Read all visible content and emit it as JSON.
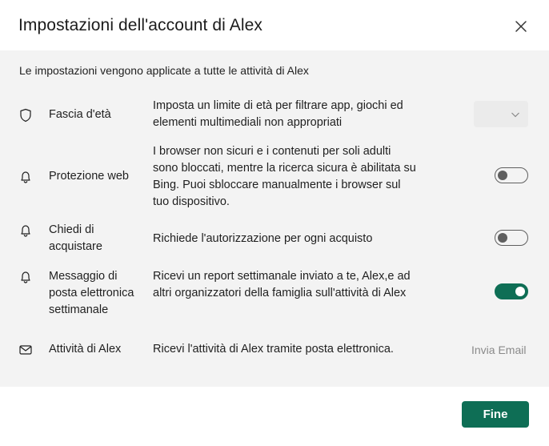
{
  "dialog": {
    "title": "Impostazioni dell'account di Alex",
    "intro": "Le impostazioni vengono applicate a tutte le attività di Alex"
  },
  "settings": [
    {
      "icon": "shield-icon",
      "name": "Fascia d'età",
      "description": "Imposta un limite di età per filtrare app, giochi ed elementi multimediali non appropriati",
      "control": "dropdown",
      "value": ""
    },
    {
      "icon": "bell-icon",
      "name": "Protezione web",
      "description": "I browser non sicuri e i contenuti per soli adulti sono bloccati, mentre la ricerca sicura è abilitata su Bing. Puoi sbloccare manualmente i browser sul tuo dispositivo.",
      "control": "toggle",
      "enabled": false
    },
    {
      "icon": "bell-icon",
      "name": "Chiedi di acquistare",
      "description": "Richiede l'autorizzazione per ogni acquisto",
      "control": "toggle",
      "enabled": false
    },
    {
      "icon": "bell-icon",
      "name": "Messaggio di posta elettronica settimanale",
      "description": "Ricevi un report settimanale inviato a te, Alex,e ad altri organizzatori della famiglia sull'attività di Alex",
      "control": "toggle",
      "enabled": true
    },
    {
      "icon": "mail-icon",
      "name": "Attività di Alex",
      "description": "Ricevi l'attività di Alex tramite posta elettronica.",
      "control": "link",
      "link_label": "Invia Email"
    }
  ],
  "footer": {
    "done_label": "Fine"
  },
  "colors": {
    "accent": "#0e6e55",
    "panel_bg": "#f3f3f3",
    "toggle_off": "#5f5f5f",
    "link_muted": "#8a8a8a"
  }
}
